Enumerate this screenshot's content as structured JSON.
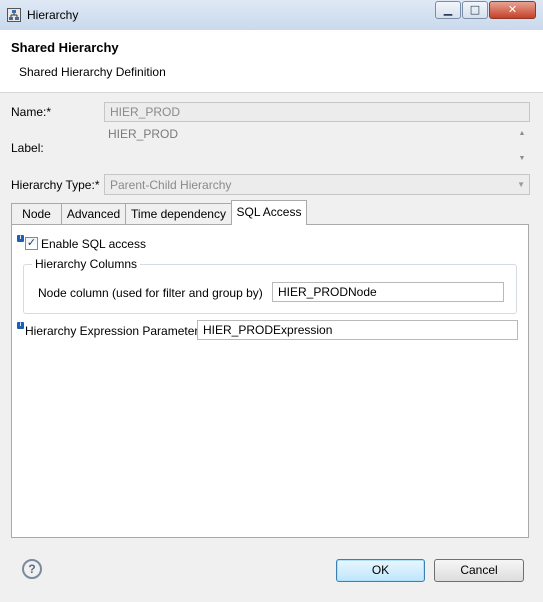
{
  "window": {
    "title": "Hierarchy",
    "controls": {
      "minimize": "▁",
      "maximize": "□",
      "close": "✕"
    }
  },
  "header": {
    "title": "Shared Hierarchy",
    "subtitle": "Shared Hierarchy Definition"
  },
  "form": {
    "name_label": "Name:*",
    "name_value": "HIER_PROD",
    "label_label": "Label:",
    "label_value": "HIER_PROD",
    "type_label": "Hierarchy Type:*",
    "type_value": "Parent-Child Hierarchy"
  },
  "tabs": [
    {
      "label": "Node",
      "active": false
    },
    {
      "label": "Advanced",
      "active": false
    },
    {
      "label": "Time dependency",
      "active": false
    },
    {
      "label": "SQL Access",
      "active": true
    }
  ],
  "sql_access": {
    "info_glyph": "i",
    "enable_checkbox_label": "Enable SQL access",
    "enable_checked": true,
    "check_glyph": "✓",
    "group_title": "Hierarchy Columns",
    "node_column_label": "Node column (used for filter and group by)",
    "node_column_value": "HIER_PRODNode",
    "expr_param_label": "Hierarchy Expression Parameter",
    "expr_param_value": "HIER_PRODExpression"
  },
  "footer": {
    "help_glyph": "?",
    "ok_label": "OK",
    "cancel_label": "Cancel"
  },
  "icons": {
    "app": "hierarchy-app-icon",
    "help": "help-icon",
    "info": "info-icon"
  },
  "colors": {
    "titlebar": "#c9d9ec",
    "close_button": "#c5412a",
    "info_icon": "#1c5fb5",
    "default_button": "#bee6fd"
  }
}
